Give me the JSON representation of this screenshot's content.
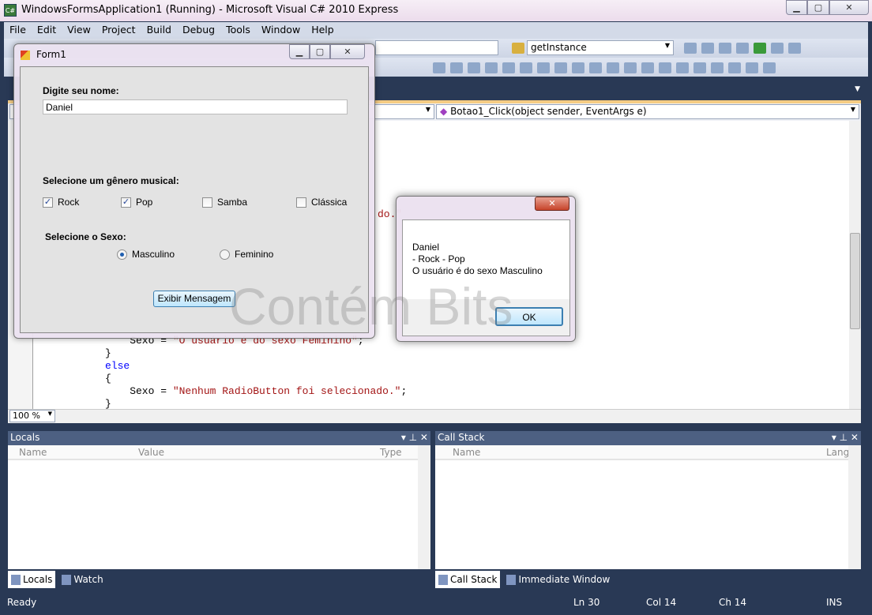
{
  "window": {
    "title": "WindowsFormsApplication1 (Running) - Microsoft Visual C# 2010 Express",
    "app_icon": "C#"
  },
  "menu": [
    "File",
    "Edit",
    "View",
    "Project",
    "Build",
    "Debug",
    "Tools",
    "Window",
    "Help"
  ],
  "toolbar": {
    "find_combo": "getInstance"
  },
  "navbar": {
    "member": "Botao1_Click(object sender, EventArgs e)"
  },
  "code": {
    "fragment": "do.\"",
    "lines": [
      {
        "pre": "    Sexo = ",
        "str": "\"O usuário é do sexo Feminino\"",
        "post": ";"
      },
      {
        "text": "}"
      },
      {
        "kw": "else"
      },
      {
        "text": "{"
      },
      {
        "pre": "    Sexo = ",
        "str": "\"Nenhum RadioButton foi selecionado.\"",
        "post": ";"
      },
      {
        "text": "}"
      }
    ]
  },
  "zoom": "100 %",
  "locals": {
    "title": "Locals",
    "columns": [
      "Name",
      "Value",
      "Type"
    ],
    "tabs": [
      "Locals",
      "Watch"
    ]
  },
  "callstack": {
    "title": "Call Stack",
    "columns": [
      "Name",
      "Lang"
    ],
    "tabs": [
      "Call Stack",
      "Immediate Window"
    ]
  },
  "status": {
    "state": "Ready",
    "ln": "Ln 30",
    "col": "Col 14",
    "ch": "Ch 14",
    "mode": "INS"
  },
  "form1": {
    "title": "Form1",
    "name_label": "Digite seu nome:",
    "name_value": "Daniel",
    "genre_label": "Selecione um gênero musical:",
    "genres": [
      {
        "label": "Rock",
        "checked": true
      },
      {
        "label": "Pop",
        "checked": true
      },
      {
        "label": "Samba",
        "checked": false
      },
      {
        "label": "Clássica",
        "checked": false
      }
    ],
    "sex_label": "Selecione o Sexo:",
    "sexes": [
      {
        "label": "Masculino",
        "selected": true
      },
      {
        "label": "Feminino",
        "selected": false
      }
    ],
    "button": "Exibir Mensagem"
  },
  "messagebox": {
    "lines": [
      "Daniel",
      "- Rock - Pop",
      "O usuário é do sexo Masculino"
    ],
    "ok": "OK"
  },
  "watermark": "Contém Bits"
}
